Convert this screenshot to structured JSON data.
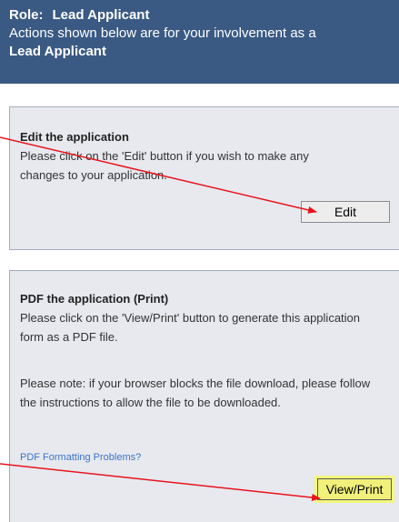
{
  "role": {
    "prefix": "Role:",
    "value": "Lead Applicant",
    "actions_text": "Actions shown below are for your involvement as a",
    "applicant_text": "Lead Applicant"
  },
  "edit_panel": {
    "title": "Edit the application",
    "text": "Please click on the 'Edit' button if you wish to make any changes to your application.",
    "button_label": "Edit"
  },
  "pdf_panel": {
    "title": "PDF the application (Print)",
    "text": "Please click on the 'View/Print' button to generate this application form as a PDF file.",
    "note": "Please note: if your browser blocks the file download, please follow the instructions to allow the file to be downloaded.",
    "link_label": "PDF Formatting Problems?",
    "button_label": "View/Print"
  },
  "colors": {
    "header_bg": "#3a5a84",
    "panel_bg": "#e7e9ef",
    "arrow": "#e8141c",
    "highlight": "#f3f77a",
    "link": "#3b73c8"
  }
}
